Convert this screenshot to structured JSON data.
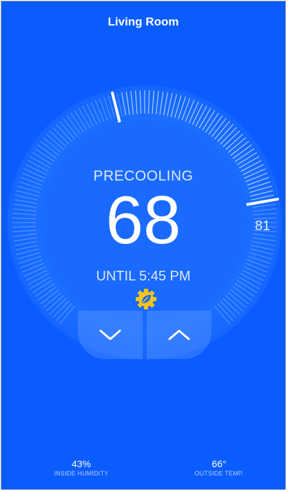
{
  "header": {
    "title": "Living Room"
  },
  "thermostat": {
    "mode": "PRECOOLING",
    "setpoint": "68",
    "until": "UNTIL 5:45 PM",
    "current_temp": "81",
    "eco_icon": "eco-leaf-gear-icon",
    "eco_color": "#f5c518",
    "accent": "#0a5cff"
  },
  "controls": {
    "down_icon": "chevron-down-icon",
    "up_icon": "chevron-up-icon"
  },
  "stats": {
    "humidity": {
      "value": "43%",
      "label": "INSIDE HUMIDITY"
    },
    "outside": {
      "value": "66°",
      "label": "OUTSIDE TEMP."
    }
  }
}
